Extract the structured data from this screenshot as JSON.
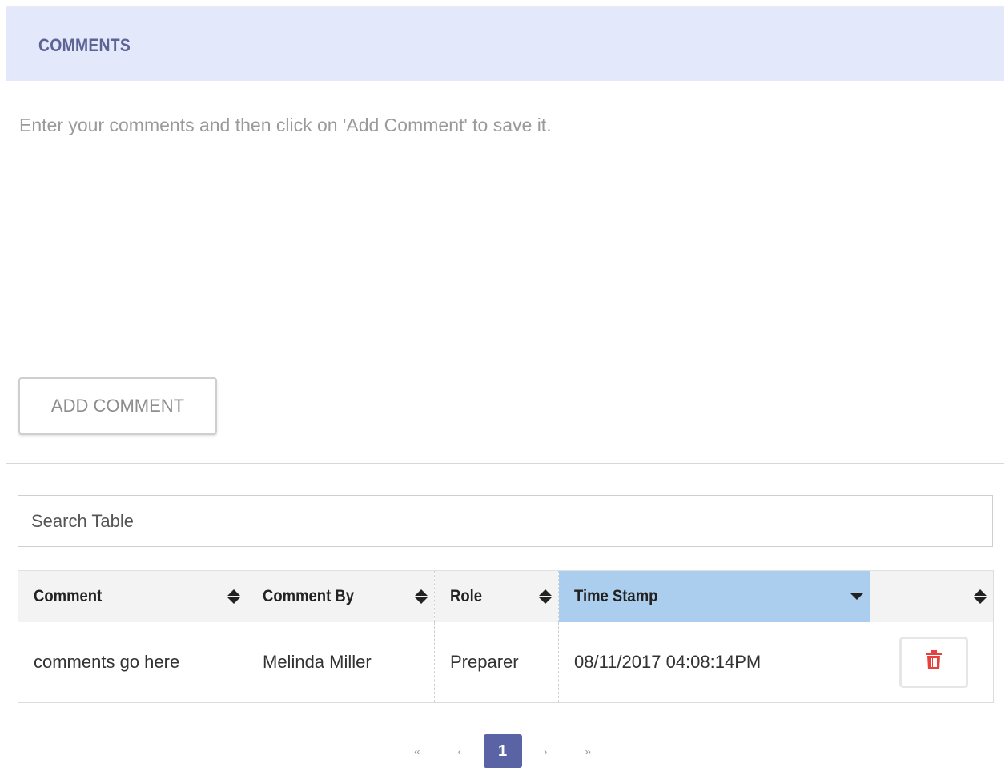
{
  "panel": {
    "title": "COMMENTS"
  },
  "comment_form": {
    "hint": "Enter your comments and then click on 'Add Comment' to save it.",
    "textarea_value": "",
    "add_button_label": "ADD COMMENT"
  },
  "search": {
    "placeholder": "Search Table",
    "value": ""
  },
  "table": {
    "columns": [
      {
        "label": "Comment",
        "sort": "both"
      },
      {
        "label": "Comment By",
        "sort": "both"
      },
      {
        "label": "Role",
        "sort": "both"
      },
      {
        "label": "Time Stamp",
        "sort": "desc",
        "active": true
      },
      {
        "label": "",
        "sort": "both"
      }
    ],
    "rows": [
      {
        "comment": "comments go here",
        "comment_by": "Melinda Miller",
        "role": "Preparer",
        "time_stamp": "08/11/2017 04:08:14PM",
        "action_icon": "trash-icon"
      }
    ]
  },
  "pagination": {
    "first": "«",
    "prev": "‹",
    "current": "1",
    "next": "›",
    "last": "»"
  },
  "colors": {
    "header_bg": "#e3e8fb",
    "title_color": "#5c6496",
    "sorted_header_bg": "#abcdee",
    "pager_active": "#5a63a4",
    "trash_icon": "#e8403a"
  }
}
